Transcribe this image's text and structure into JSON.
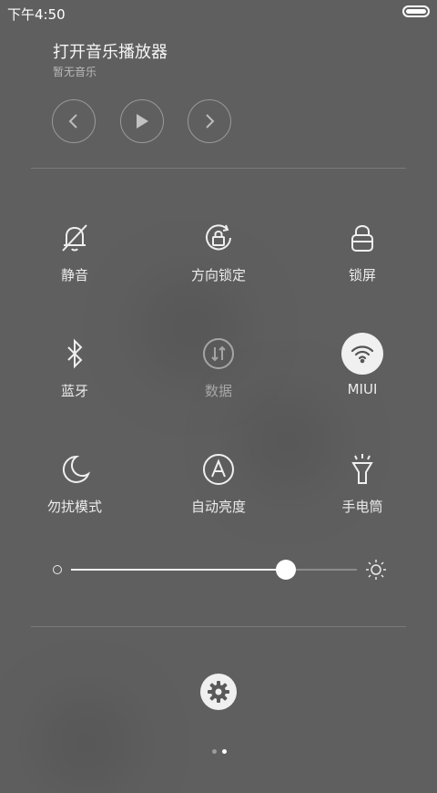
{
  "status_bar": {
    "time": "下午4:50",
    "battery_icon": "battery-full-icon"
  },
  "music": {
    "title": "打开音乐播放器",
    "subtitle": "暂无音乐",
    "controls": [
      "previous-icon",
      "play-icon",
      "next-icon"
    ]
  },
  "toggles": [
    {
      "label": "静音",
      "icon": "bell-off-icon",
      "state": "off"
    },
    {
      "label": "方向锁定",
      "icon": "rotation-lock-icon",
      "state": "off"
    },
    {
      "label": "锁屏",
      "icon": "lock-icon",
      "state": "off"
    },
    {
      "label": "蓝牙",
      "icon": "bluetooth-icon",
      "state": "off"
    },
    {
      "label": "数据",
      "icon": "mobile-data-icon",
      "state": "disabled"
    },
    {
      "label": "MIUI",
      "icon": "wifi-icon",
      "state": "on"
    },
    {
      "label": "勿扰模式",
      "icon": "moon-icon",
      "state": "off"
    },
    {
      "label": "自动亮度",
      "icon": "auto-brightness-icon",
      "state": "off"
    },
    {
      "label": "手电筒",
      "icon": "flashlight-icon",
      "state": "off"
    }
  ],
  "brightness": {
    "level": 0.75,
    "min_icon": "brightness-low-icon",
    "max_icon": "brightness-high-icon"
  },
  "settings_icon": "gear-icon",
  "pager": {
    "pages": 2,
    "current": 2
  },
  "colors": {
    "background": "#5f5f5f",
    "active_toggle": "#f0f0f0"
  }
}
